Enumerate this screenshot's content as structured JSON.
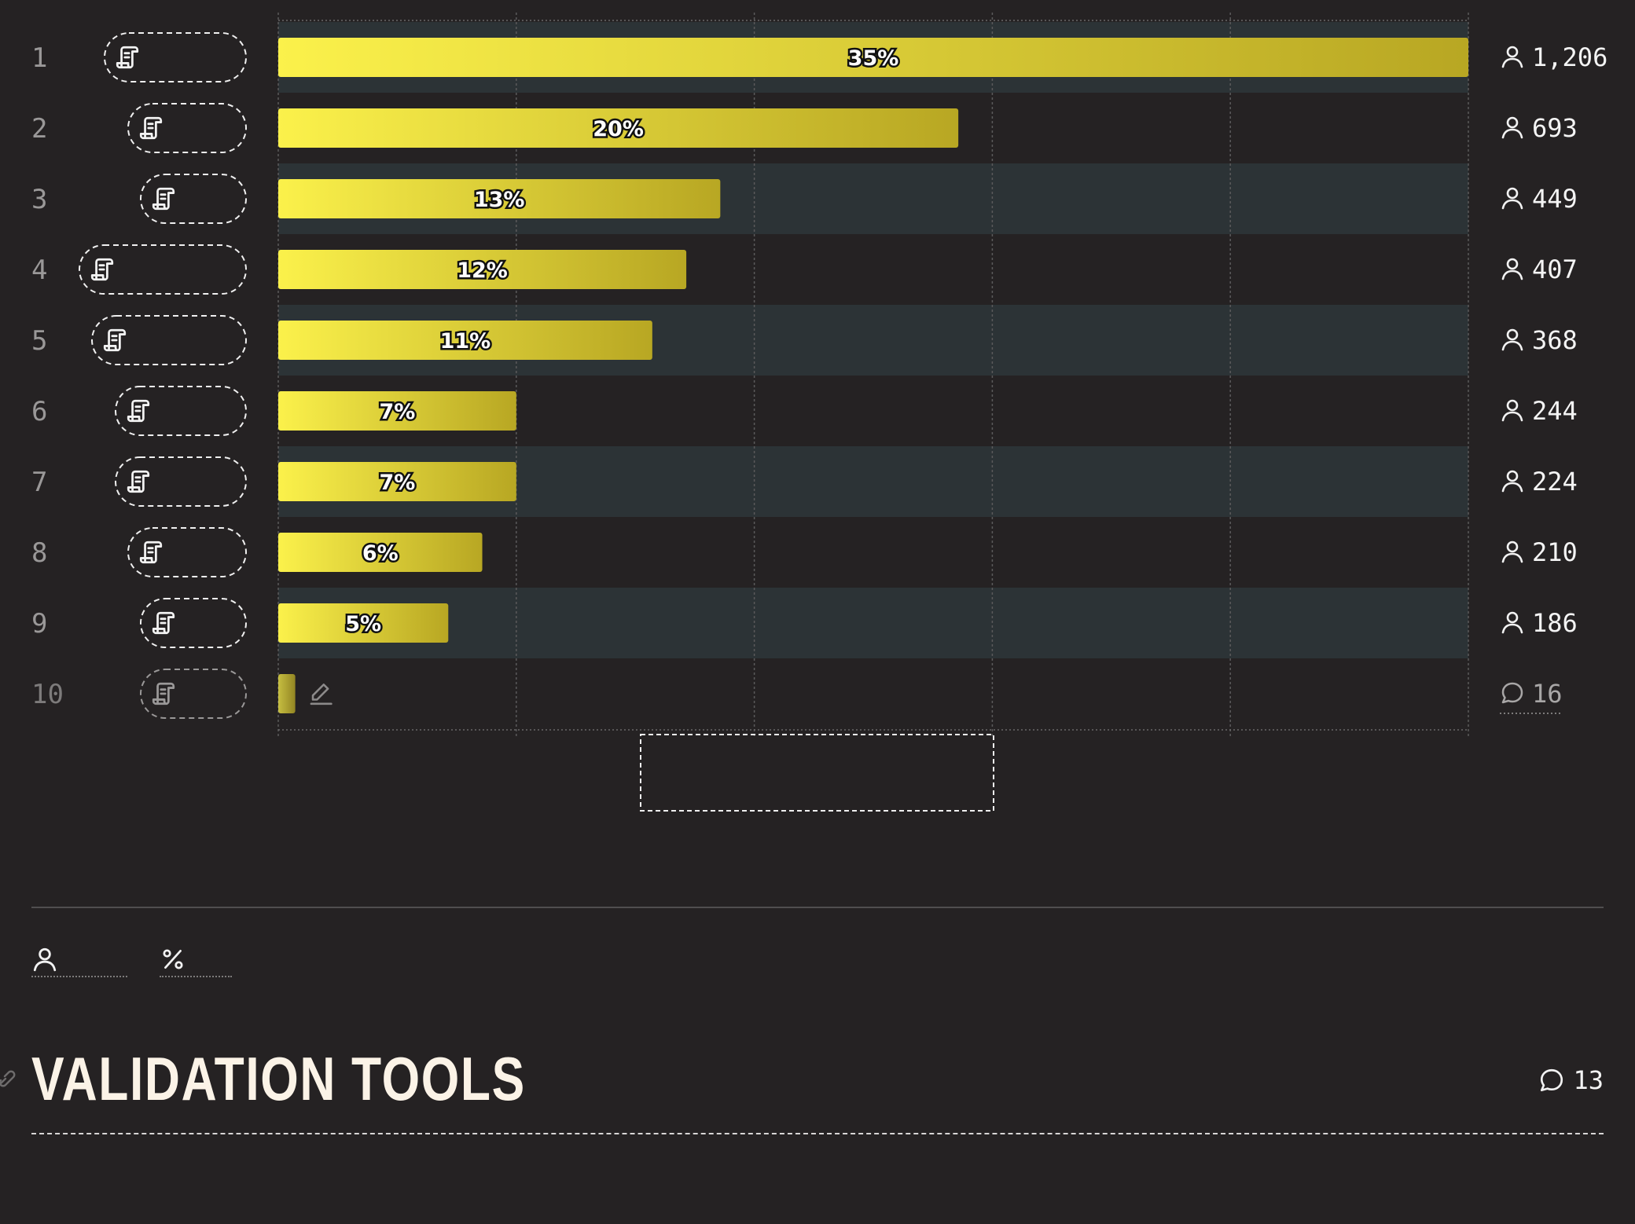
{
  "chart_data": {
    "type": "bar",
    "orientation": "horizontal",
    "categories": [
      "1",
      "2",
      "3",
      "4",
      "5",
      "6",
      "7",
      "8",
      "9",
      "10"
    ],
    "series": [
      {
        "values": [
          35,
          20,
          13,
          12,
          11,
          7,
          7,
          6,
          5,
          0.5
        ]
      }
    ],
    "value_labels": [
      "35%",
      "20%",
      "13%",
      "12%",
      "11%",
      "7%",
      "7%",
      "6%",
      "5%",
      ""
    ],
    "counts": [
      "1,206",
      "693",
      "449",
      "407",
      "368",
      "244",
      "224",
      "210",
      "186",
      "16"
    ],
    "count_icons": [
      "person-icon",
      "person-icon",
      "person-icon",
      "person-icon",
      "person-icon",
      "person-icon",
      "person-icon",
      "person-icon",
      "person-icon",
      "comment-icon"
    ],
    "row_icons": [
      "scroll-icon",
      "scroll-icon",
      "scroll-icon",
      "scroll-icon",
      "scroll-icon",
      "scroll-icon",
      "scroll-icon",
      "scroll-icon",
      "scroll-icon",
      "scroll-icon"
    ],
    "xlim": [
      0,
      35
    ],
    "grid": true,
    "bar_gradient": [
      "#fbf14b",
      "#b8a723"
    ],
    "row_stripe_color": "#2c3336",
    "last_row_style": "muted, with edit-icon"
  },
  "legend": [
    {
      "icon": "person-icon",
      "label": ""
    },
    {
      "icon": "percent-icon",
      "label": ""
    }
  ],
  "section": {
    "title": "VALIDATION TOOLS",
    "comment_count": "13"
  },
  "colors": {
    "background": "#252223",
    "title": "#fbf3e7",
    "text": "#f4f4f4",
    "muted": "#9a9898"
  }
}
